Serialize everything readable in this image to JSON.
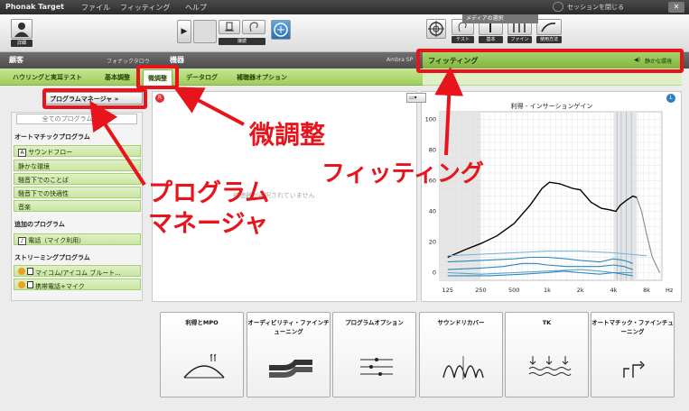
{
  "app": {
    "title": "Phonak Target",
    "menus": [
      "ファイル",
      "フィッティング",
      "ヘルプ"
    ],
    "close_session": "セッションを閉じる",
    "message_label": "メディアの選択"
  },
  "toolbar": {
    "detail_label": "詳細",
    "connect_label": "接続",
    "right_buttons": [
      "テスト",
      "基本",
      "ファイン",
      "使用方法"
    ]
  },
  "header": {
    "client_label": "顧客",
    "client_name": "フォナックタロウ",
    "device_label": "機器",
    "device_name": "Ambra SP",
    "fitting_label": "フィッティング",
    "environment_label": "静かな環境"
  },
  "tabs": [
    "ハウリングと実耳テスト",
    "基本調整",
    "微調整",
    "データログ",
    "補聴器オプション"
  ],
  "program_manager": {
    "button_label": "プログラムマネージャ »",
    "select_all": "全てのプログラムを選択",
    "auto_section": "オートマチックプログラム",
    "auto_items": [
      {
        "badge": "A",
        "label": "サウンドフロー"
      },
      {
        "badge": "",
        "label": "静かな環境"
      },
      {
        "badge": "",
        "label": "騒音下でのことば"
      },
      {
        "badge": "",
        "label": "騒音下での快適性"
      },
      {
        "badge": "",
        "label": "音楽"
      }
    ],
    "extra_section": "追加のプログラム",
    "extra_items": [
      {
        "badge": "♪",
        "label": "電話（マイク利用）"
      }
    ],
    "stream_section": "ストリーミングプログラム",
    "stream_items": [
      {
        "label": "マイコム/アイコム ブルート..."
      },
      {
        "label": "携帯電話+マイク"
      }
    ]
  },
  "middle_panel": {
    "message": "補聴器が選択されていません"
  },
  "chart_data": {
    "type": "line",
    "title": "利得 - インサーションゲイン",
    "x_ticks": [
      "125",
      "250",
      "500",
      "1k",
      "2k",
      "4k",
      "8k"
    ],
    "x_unit": "Hz",
    "y_ticks": [
      "0",
      "20",
      "40",
      "60",
      "80",
      "100"
    ],
    "ylim": [
      -5,
      105
    ],
    "grid": true,
    "series": [
      {
        "color": "#000000",
        "points": [
          [
            125,
            10
          ],
          [
            180,
            15
          ],
          [
            250,
            19
          ],
          [
            350,
            24
          ],
          [
            500,
            32
          ],
          [
            700,
            44
          ],
          [
            900,
            55
          ],
          [
            1050,
            59
          ],
          [
            1300,
            58
          ],
          [
            1700,
            55
          ],
          [
            2000,
            54
          ],
          [
            2500,
            46
          ],
          [
            3100,
            42
          ],
          [
            3700,
            41
          ],
          [
            4200,
            40
          ],
          [
            4600,
            44
          ],
          [
            5200,
            47
          ],
          [
            6000,
            50
          ],
          [
            6500,
            49
          ]
        ]
      },
      {
        "color": "#888888",
        "points": [
          [
            6500,
            49
          ],
          [
            7200,
            40
          ],
          [
            8000,
            25
          ],
          [
            9000,
            10
          ],
          [
            10500,
            0
          ]
        ]
      },
      {
        "color": "#7ab8dc",
        "points": [
          [
            125,
            11
          ],
          [
            250,
            12
          ],
          [
            500,
            13
          ],
          [
            1000,
            14
          ],
          [
            2000,
            14
          ],
          [
            4000,
            13
          ],
          [
            8000,
            11
          ]
        ]
      },
      {
        "color": "#2c88bd",
        "points": [
          [
            125,
            7
          ],
          [
            250,
            8
          ],
          [
            500,
            9
          ],
          [
            700,
            10
          ],
          [
            1000,
            10
          ],
          [
            1500,
            9
          ],
          [
            2000,
            8
          ],
          [
            3000,
            7
          ],
          [
            4000,
            9
          ],
          [
            5000,
            8
          ],
          [
            6000,
            6
          ]
        ]
      },
      {
        "color": "#2c88bd",
        "points": [
          [
            125,
            2
          ],
          [
            250,
            3
          ],
          [
            400,
            4
          ],
          [
            600,
            6
          ],
          [
            800,
            6
          ],
          [
            1000,
            5
          ],
          [
            1500,
            4
          ],
          [
            2000,
            4
          ],
          [
            3000,
            4
          ],
          [
            4000,
            5
          ],
          [
            5000,
            4
          ],
          [
            6000,
            2
          ]
        ]
      },
      {
        "color": "#5aa4cf",
        "points": [
          [
            125,
            0
          ],
          [
            250,
            -1
          ],
          [
            500,
            0
          ],
          [
            1000,
            1
          ],
          [
            2000,
            2
          ],
          [
            3000,
            1
          ],
          [
            4000,
            0
          ],
          [
            6000,
            0
          ]
        ]
      },
      {
        "color": "#2c88bd",
        "points": [
          [
            125,
            -2
          ],
          [
            300,
            -2
          ],
          [
            600,
            -1
          ],
          [
            1000,
            0
          ],
          [
            1400,
            1
          ],
          [
            2000,
            0
          ],
          [
            3000,
            -1
          ],
          [
            4000,
            0
          ],
          [
            6000,
            -2
          ]
        ]
      }
    ]
  },
  "cards": [
    "利得とMPO",
    "オーディビリティ・ファインチューニング",
    "プログラムオプション",
    "サウンドリカバー",
    "TK",
    "オートマチック・ファインチューニング"
  ],
  "annotations": {
    "fine_tuning": "微調整",
    "fitting": "フィッティング",
    "program_manager_1": "プログラム",
    "program_manager_2": "マネージャ"
  },
  "colors": {
    "annotation": "#e8141c",
    "green_bar": "#9fcd5c",
    "chart_blue": "#2c88bd"
  }
}
